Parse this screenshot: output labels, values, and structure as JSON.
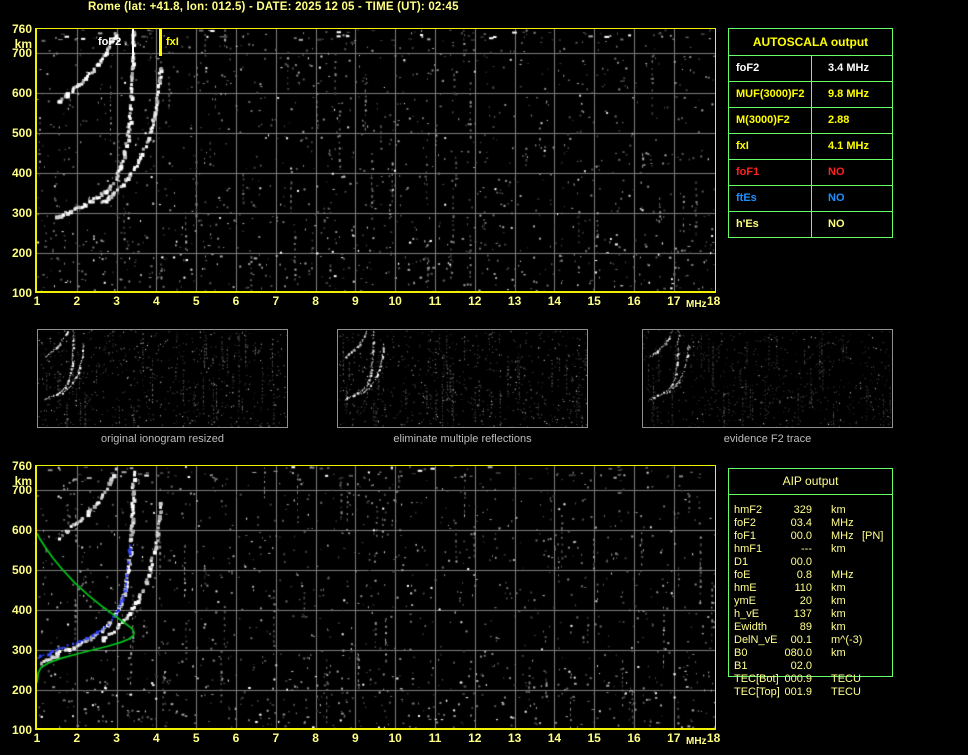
{
  "header": {
    "title": "Rome (lat: +41.8, lon: 012.5) - DATE: 2025 12 05 - TIME (UT): 02:45"
  },
  "colors": {
    "background": "#000000",
    "title_text": "#FFFF84",
    "plot_border": "#F0F000",
    "grid": "#7D7D7D",
    "axis_text": "#FFFF84",
    "table_border": "#66FF66",
    "autoscala_header_text": "#FFFF00",
    "aip_text": "#FFFF8C",
    "caption_text": "#BDBDBD",
    "trace_white": "#FFFFFF",
    "trace_blue": "#2B3BFF",
    "profile_green": "#00C818",
    "fof2_marker": "#FFFFFF",
    "fxi_marker": "#FFFF00"
  },
  "autoscala_table": {
    "title": "AUTOSCALA output",
    "rows": [
      {
        "label": "foF2",
        "value": "3.4 MHz",
        "color": "#FFFFFF"
      },
      {
        "label": "MUF(3000)F2",
        "value": "9.8 MHz",
        "color": "#FFFF00"
      },
      {
        "label": "M(3000)F2",
        "value": "2.88",
        "color": "#FFFF00"
      },
      {
        "label": "fxI",
        "value": "4.1 MHz",
        "color": "#FFFF00"
      },
      {
        "label": "foF1",
        "value": "NO",
        "color": "#FF2020"
      },
      {
        "label": "ftEs",
        "value": "NO",
        "color": "#1E90FF"
      },
      {
        "label": "h'Es",
        "value": "NO",
        "color": "#FFFF80"
      }
    ]
  },
  "aip_table": {
    "title": "AIP output",
    "rows": [
      {
        "label": "hmF2",
        "value": "329",
        "unit": "km",
        "note": ""
      },
      {
        "label": "foF2",
        "value": "03.4",
        "unit": "MHz",
        "note": ""
      },
      {
        "label": "foF1",
        "value": "00.0",
        "unit": "MHz",
        "note": "[PN]"
      },
      {
        "label": "hmF1",
        "value": "---",
        "unit": "km",
        "note": ""
      },
      {
        "label": "D1",
        "value": "00.0",
        "unit": "",
        "note": ""
      },
      {
        "label": "foE",
        "value": "0.8",
        "unit": "MHz",
        "note": ""
      },
      {
        "label": "hmE",
        "value": "110",
        "unit": "km",
        "note": ""
      },
      {
        "label": "ymE",
        "value": "20",
        "unit": "km",
        "note": ""
      },
      {
        "label": "h_vE",
        "value": "137",
        "unit": "km",
        "note": ""
      },
      {
        "label": "Ewidth",
        "value": "89",
        "unit": "km",
        "note": ""
      },
      {
        "label": "DelN_vE",
        "value": "00.1",
        "unit": "m^(-3)",
        "note": ""
      },
      {
        "label": "B0",
        "value": "080.0",
        "unit": "km",
        "note": ""
      },
      {
        "label": "B1",
        "value": "02.0",
        "unit": "",
        "note": ""
      },
      {
        "label": "TEC[Bot]",
        "value": "000.9",
        "unit": "TECU",
        "note": ""
      },
      {
        "label": "TEC[Top]",
        "value": "001.9",
        "unit": "TECU",
        "note": ""
      }
    ]
  },
  "thumbnails": [
    {
      "caption": "original ionogram resized"
    },
    {
      "caption": "eliminate multiple reflections"
    },
    {
      "caption": "evidence F2 trace"
    }
  ],
  "chart_data": {
    "type": "scatter",
    "plots": [
      {
        "id": "ionogram_autoscaled",
        "xlabel": "MHz",
        "ylabel": "km",
        "xlim": [
          1,
          18
        ],
        "ylim": [
          100,
          760
        ],
        "x_ticks": [
          1,
          2,
          3,
          4,
          5,
          6,
          7,
          8,
          9,
          10,
          11,
          12,
          13,
          14,
          15,
          16,
          17,
          18
        ],
        "y_ticks": [
          760,
          700,
          600,
          500,
          400,
          300,
          200,
          100
        ],
        "grid": true,
        "annotations": {
          "foF2_label": "foF2",
          "foF2_MHz": 3.4,
          "fxI_label": "fxI",
          "fxI_MHz": 4.1
        },
        "series": [
          "o_trace",
          "x_trace",
          "second_hop"
        ]
      },
      {
        "id": "ionogram_with_profile",
        "xlabel": "MHz",
        "ylabel": "km",
        "xlim": [
          1,
          18
        ],
        "ylim": [
          100,
          760
        ],
        "x_ticks": [
          1,
          2,
          3,
          4,
          5,
          6,
          7,
          8,
          9,
          10,
          11,
          12,
          13,
          14,
          15,
          16,
          17,
          18
        ],
        "y_ticks": [
          760,
          700,
          600,
          500,
          400,
          300,
          200,
          100
        ],
        "grid": true,
        "series": [
          "o_trace_extension",
          "o_trace",
          "x_trace",
          "second_hop",
          "restored_trace",
          "density_profile"
        ]
      }
    ],
    "traces": {
      "o_trace": {
        "name": "F2 ordinary trace",
        "style": "white-dots",
        "points": [
          [
            1.45,
            293
          ],
          [
            1.7,
            303
          ],
          [
            2.0,
            316
          ],
          [
            2.3,
            331
          ],
          [
            2.6,
            350
          ],
          [
            2.8,
            369
          ],
          [
            2.95,
            391
          ],
          [
            3.08,
            420
          ],
          [
            3.18,
            455
          ],
          [
            3.26,
            497
          ],
          [
            3.31,
            543
          ],
          [
            3.34,
            592
          ],
          [
            3.36,
            642
          ],
          [
            3.38,
            695
          ],
          [
            3.4,
            757
          ]
        ]
      },
      "o_trace_extension": {
        "name": "F2 trace low-frequency extension",
        "style": "white-dots",
        "points": [
          [
            1.0,
            266
          ],
          [
            1.2,
            276
          ],
          [
            1.45,
            289
          ]
        ]
      },
      "x_trace": {
        "name": "F2 extraordinary trace",
        "style": "white-dots",
        "points": [
          [
            2.6,
            328
          ],
          [
            2.8,
            344
          ],
          [
            3.0,
            362
          ],
          [
            3.2,
            384
          ],
          [
            3.4,
            410
          ],
          [
            3.55,
            438
          ],
          [
            3.7,
            472
          ],
          [
            3.82,
            508
          ],
          [
            3.92,
            548
          ],
          [
            4.0,
            592
          ],
          [
            4.05,
            635
          ],
          [
            4.08,
            668
          ]
        ]
      },
      "second_hop": {
        "name": "multiple reflection trace",
        "style": "white-dots",
        "points": [
          [
            1.5,
            582
          ],
          [
            1.7,
            598
          ],
          [
            1.9,
            614
          ],
          [
            2.1,
            631
          ],
          [
            2.3,
            651
          ],
          [
            2.5,
            673
          ],
          [
            2.65,
            695
          ],
          [
            2.78,
            718
          ],
          [
            2.9,
            742
          ],
          [
            2.98,
            760
          ]
        ]
      },
      "restored_trace": {
        "name": "restored F2 trace",
        "style": "blue-dots",
        "points": [
          [
            1.0,
            284
          ],
          [
            1.3,
            296
          ],
          [
            1.6,
            307
          ],
          [
            1.9,
            318
          ],
          [
            2.2,
            331
          ],
          [
            2.5,
            347
          ],
          [
            2.75,
            366
          ],
          [
            2.95,
            390
          ],
          [
            3.08,
            418
          ],
          [
            3.17,
            450
          ],
          [
            3.23,
            485
          ],
          [
            3.27,
            520
          ],
          [
            3.3,
            550
          ],
          [
            3.31,
            562
          ]
        ]
      },
      "density_profile": {
        "name": "electron density profile",
        "style": "green-line",
        "points": [
          [
            1.0,
            218
          ],
          [
            1.03,
            242
          ],
          [
            1.1,
            256
          ],
          [
            1.3,
            268
          ],
          [
            1.6,
            279
          ],
          [
            2.0,
            290
          ],
          [
            2.4,
            300
          ],
          [
            2.8,
            310
          ],
          [
            3.1,
            319
          ],
          [
            3.3,
            327
          ],
          [
            3.42,
            336
          ],
          [
            3.44,
            344
          ],
          [
            3.38,
            354
          ],
          [
            3.2,
            368
          ],
          [
            2.95,
            386
          ],
          [
            2.65,
            408
          ],
          [
            2.3,
            436
          ],
          [
            1.95,
            468
          ],
          [
            1.65,
            500
          ],
          [
            1.4,
            530
          ],
          [
            1.2,
            558
          ],
          [
            1.07,
            578
          ],
          [
            1.0,
            592
          ]
        ]
      }
    }
  }
}
